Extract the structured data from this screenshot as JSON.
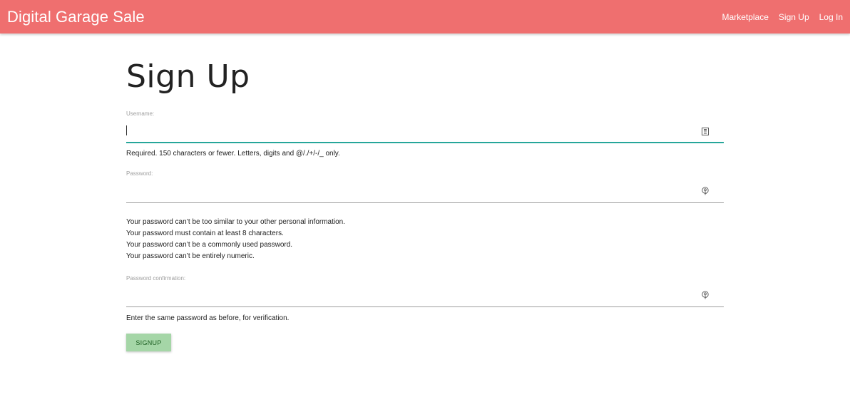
{
  "navbar": {
    "brand": "Digital Garage Sale",
    "links": [
      "Marketplace",
      "Sign Up",
      "Log In"
    ]
  },
  "page": {
    "title": "Sign Up"
  },
  "form": {
    "username": {
      "label": "Username:",
      "value": "",
      "help": "Required. 150 characters or fewer. Letters, digits and @/./+/-/_ only."
    },
    "password": {
      "label": "Password:",
      "value": "",
      "help": [
        "Your password can’t be too similar to your other personal information.",
        "Your password must contain at least 8 characters.",
        "Your password can’t be a commonly used password.",
        "Your password can’t be entirely numeric."
      ]
    },
    "password_confirmation": {
      "label": "Password confirmation:",
      "value": "",
      "help": "Enter the same password as before, for verification."
    },
    "submit_label": "SIGNUP"
  },
  "colors": {
    "navbar": "#ef6f6f",
    "active_underline": "#26a69a",
    "button": "#a5d6a7"
  },
  "icons": {
    "username_field": "id-card-icon",
    "password_field": "key-icon",
    "password_confirmation_field": "key-icon"
  }
}
